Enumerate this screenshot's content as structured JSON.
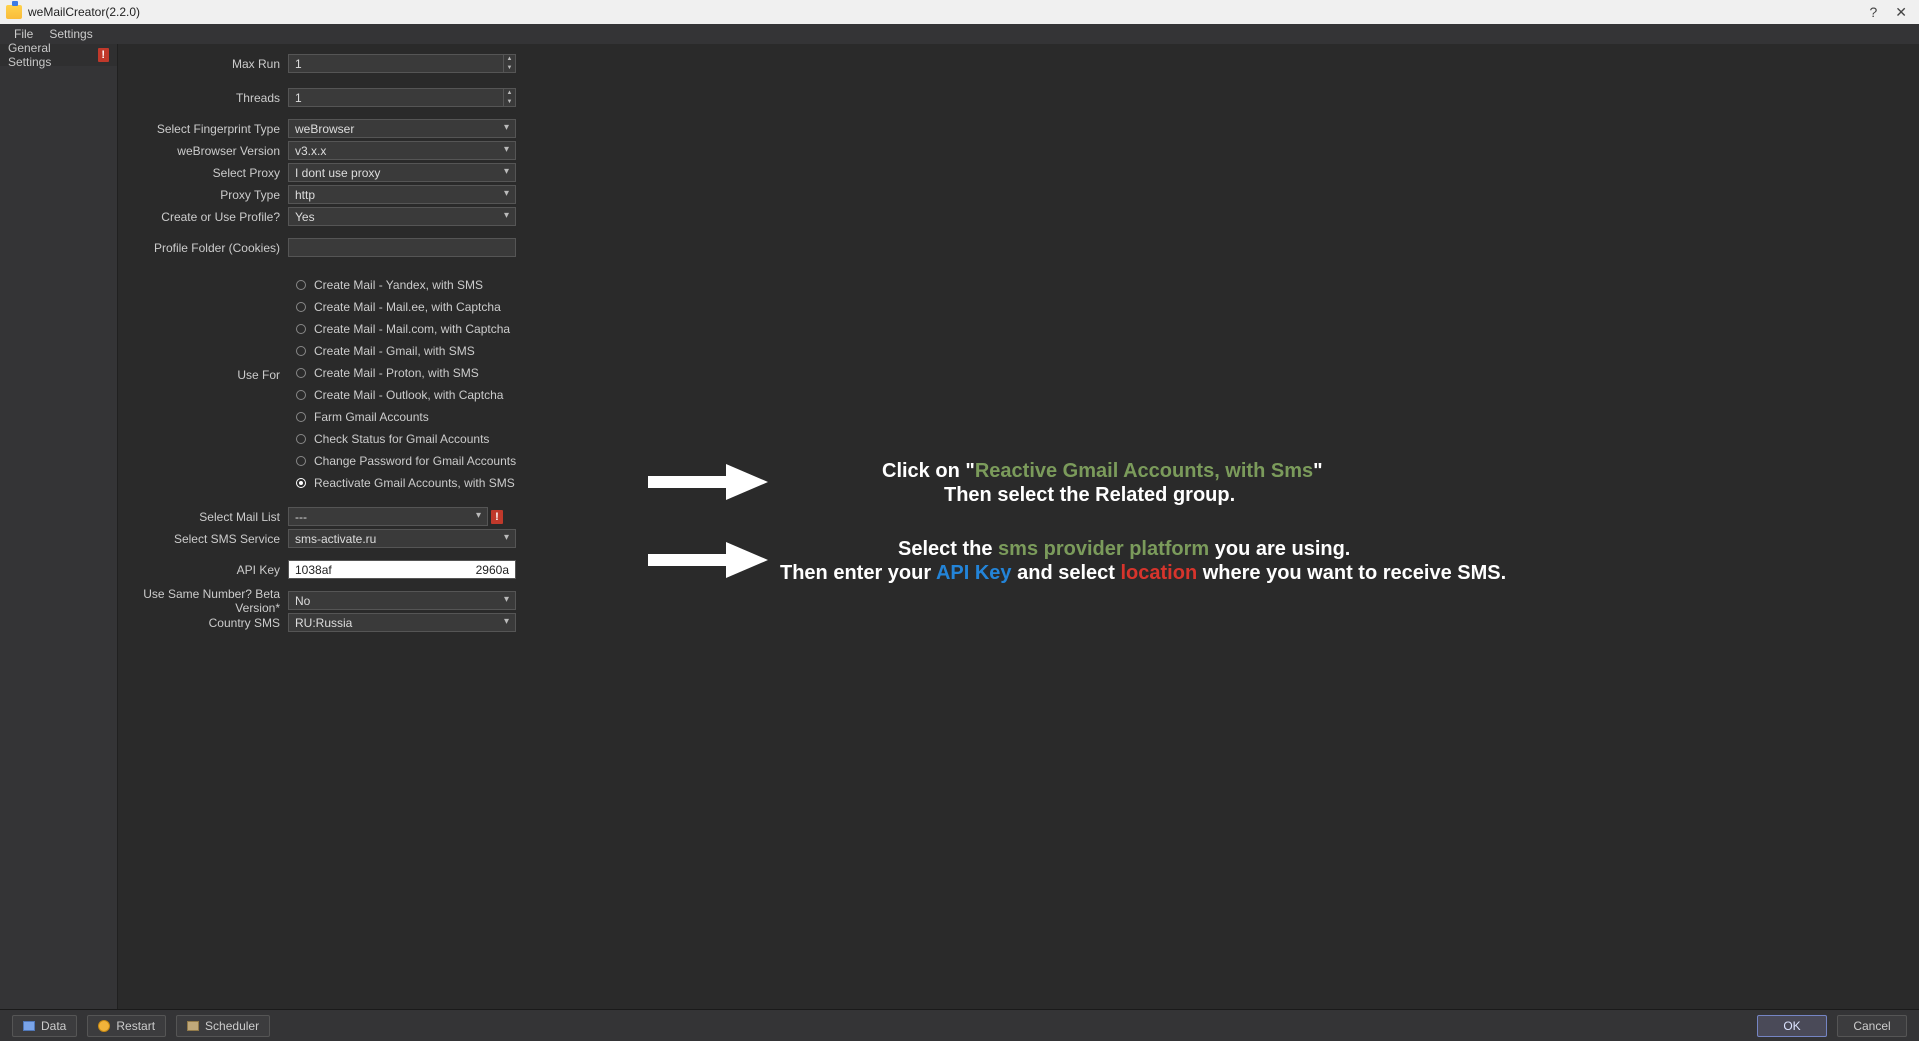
{
  "title": "weMailCreator(2.2.0)",
  "menu": {
    "file": "File",
    "settings": "Settings"
  },
  "sidebar": {
    "tab_label": "General Settings"
  },
  "form": {
    "max_run_label": "Max Run",
    "max_run_value": "1",
    "threads_label": "Threads",
    "threads_value": "1",
    "fingerprint_label": "Select Fingerprint Type",
    "fingerprint_value": "weBrowser",
    "webrowser_label": "weBrowser Version",
    "webrowser_value": "v3.x.x",
    "proxy_label": "Select Proxy",
    "proxy_value": "I dont use proxy",
    "proxy_type_label": "Proxy Type",
    "proxy_type_value": "http",
    "profile_label": "Create or Use Profile?",
    "profile_value": "Yes",
    "profile_folder_label": "Profile Folder (Cookies)",
    "profile_folder_value": "",
    "use_for_label": "Use For",
    "use_for_options": [
      "Create Mail - Yandex, with SMS",
      "Create Mail - Mail.ee, with Captcha",
      "Create Mail - Mail.com, with Captcha",
      "Create Mail - Gmail, with SMS",
      "Create Mail - Proton, with SMS",
      "Create Mail - Outlook, with Captcha",
      "Farm Gmail Accounts",
      "Check Status for Gmail Accounts",
      "Change Password for Gmail Accounts",
      "Reactivate Gmail Accounts, with SMS"
    ],
    "use_for_selected_index": 9,
    "mail_list_label": "Select Mail List",
    "mail_list_value": "---",
    "sms_service_label": "Select SMS Service",
    "sms_service_value": "sms-activate.ru",
    "api_key_label": "API Key",
    "api_key_value_visible_prefix": "1038af",
    "api_key_value_visible_suffix": "2960a",
    "same_number_label": "Use Same Number? Beta Version*",
    "same_number_value": "No",
    "country_label": "Country SMS",
    "country_value": "RU:Russia"
  },
  "annotations": {
    "line1_a": "Click on \"",
    "line1_b": "Reactive Gmail Accounts, with Sms",
    "line1_c": "\"",
    "line2": "Then select the Related group.",
    "line3_a": "Select the ",
    "line3_b": "sms provider platform",
    "line3_c": " you are using.",
    "line4_a": "Then enter your ",
    "line4_b": "API Key",
    "line4_c": " and select ",
    "line4_d": "location",
    "line4_e": " where you want to receive SMS."
  },
  "footer": {
    "data": "Data",
    "restart": "Restart",
    "scheduler": "Scheduler",
    "ok": "OK",
    "cancel": "Cancel"
  },
  "titlebar": {
    "help": "?",
    "close": "✕"
  },
  "warn_glyph": "!"
}
